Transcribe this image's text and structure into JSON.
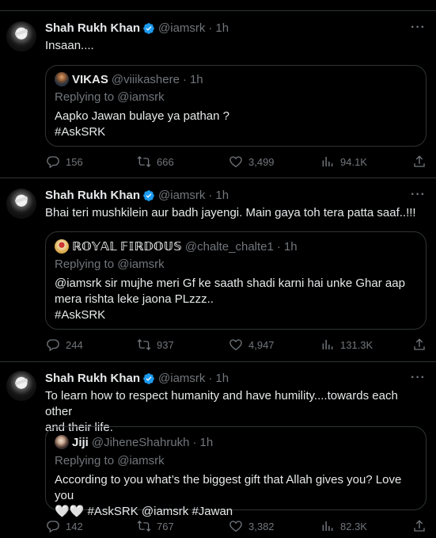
{
  "tweets": [
    {
      "author": {
        "name": "Shah Rukh Khan",
        "handle": "@iamsrk",
        "verified": true
      },
      "time": "1h",
      "text": "Insaan....",
      "quote": {
        "name": "VIKAS",
        "handle": "@viiikashere",
        "time": "1h",
        "replying": "Replying to @iamsrk",
        "text_lines": [
          "Aapko Jawan bulaye ya pathan ?",
          "#AskSRK"
        ]
      },
      "stats": {
        "replies": "156",
        "retweets": "666",
        "likes": "3,499",
        "views": "94.1K"
      }
    },
    {
      "author": {
        "name": "Shah Rukh Khan",
        "handle": "@iamsrk",
        "verified": true
      },
      "time": "1h",
      "text": "Bhai teri mushkilein aur badh jayengi. Main gaya toh tera patta saaf..!!!",
      "quote": {
        "name": "ℝ𝕆𝕐𝔸𝕃 𝔽𝕀ℝ𝔻𝕆𝕌𝕊",
        "handle": "@chalte_chalte1",
        "time": "1h",
        "replying": "Replying to @iamsrk",
        "text_lines": [
          "@iamsrk  sir mujhe meri Gf ke saath shadi karni hai unke Ghar aap",
          "mera rishta leke jaona PLzzz..",
          "#AskSRK"
        ]
      },
      "stats": {
        "replies": "244",
        "retweets": "937",
        "likes": "4,947",
        "views": "131.3K"
      }
    },
    {
      "author": {
        "name": "Shah Rukh Khan",
        "handle": "@iamsrk",
        "verified": true
      },
      "time": "1h",
      "text_lines": [
        "To learn how to respect humanity and have humility....towards each other",
        "and their life."
      ],
      "quote": {
        "name": "Jiji",
        "handle": "@JiheneShahrukh",
        "time": "1h",
        "replying": "Replying to @iamsrk",
        "text_lines": [
          "According to you what’s the biggest gift that Allah gives you? Love you",
          "🤍🤍 #AskSRK @iamsrk #Jawan"
        ]
      },
      "stats": {
        "replies": "142",
        "retweets": "767",
        "likes": "3,382",
        "views": "82.3K"
      }
    }
  ],
  "ui": {
    "more_glyph": "···",
    "dot": "·"
  },
  "colors": {
    "verified": "#1d9bf0",
    "muted": "#71767b",
    "border": "#2f3336",
    "text": "#e7e9ea"
  }
}
